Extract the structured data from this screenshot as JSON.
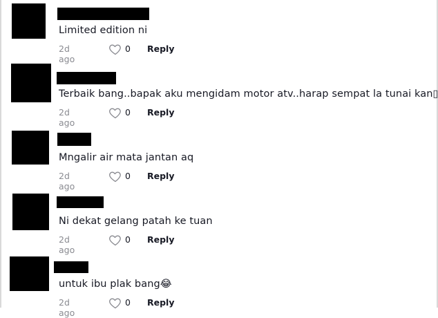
{
  "comments": [
    {
      "text": "Limited edition ni",
      "time": "2d ago",
      "likes": "0",
      "reply_label": "Reply"
    },
    {
      "text": "Terbaik bang..bapak aku mengidam motor atv..harap sempat la tunai kan▯▯▯",
      "time": "2d ago",
      "likes": "0",
      "reply_label": "Reply"
    },
    {
      "text": "Mngalir air mata jantan aq",
      "time": "2d ago",
      "likes": "0",
      "reply_label": "Reply"
    },
    {
      "text": "Ni dekat gelang patah ke tuan",
      "time": "2d ago",
      "likes": "0",
      "reply_label": "Reply"
    },
    {
      "text": "untuk ibu plak bang😂",
      "time": "2d ago",
      "likes": "0",
      "reply_label": "Reply"
    }
  ],
  "icons": {
    "like": "heart-outline-icon"
  },
  "colors": {
    "meta_gray": "#8a8b91",
    "text": "#161823",
    "redaction": "#000000"
  }
}
